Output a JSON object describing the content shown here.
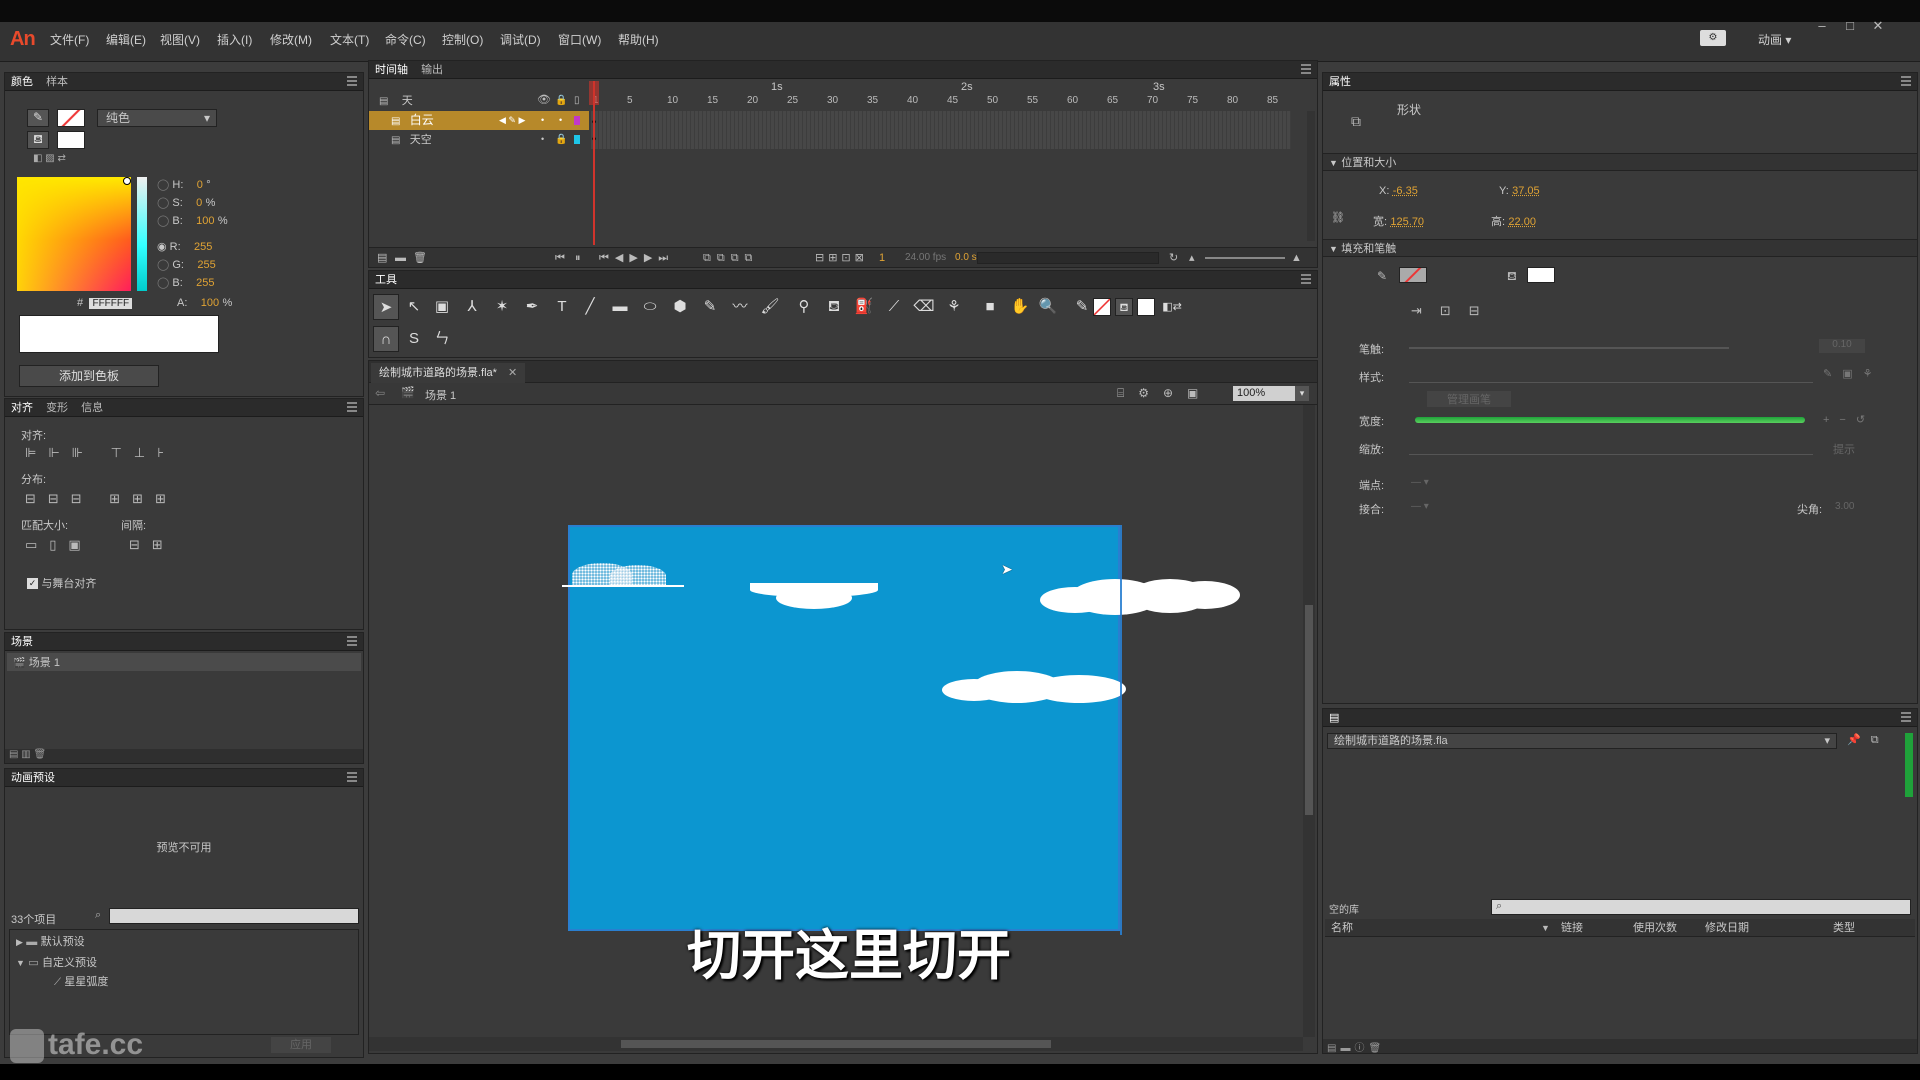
{
  "app": {
    "logo": "An",
    "workspace": "动画"
  },
  "menu": [
    "文件(F)",
    "编辑(E)",
    "视图(V)",
    "插入(I)",
    "修改(M)",
    "文本(T)",
    "命令(C)",
    "控制(O)",
    "调试(D)",
    "窗口(W)",
    "帮助(H)"
  ],
  "color_panel": {
    "tabs": [
      "颜色",
      "样本"
    ],
    "fill_type": "纯色",
    "hsb": {
      "h_label": "H:",
      "h": "0",
      "h_unit": "°",
      "s_label": "S:",
      "s": "0",
      "s_unit": "%",
      "b_label": "B:",
      "b": "100",
      "b_unit": "%"
    },
    "rgb": {
      "r_label": "R:",
      "r": "255",
      "g_label": "G:",
      "g": "255",
      "b_label": "B:",
      "b": "255"
    },
    "hex_label": "#",
    "hex": "FFFFFF",
    "alpha_label": "A:",
    "alpha": "100",
    "alpha_unit": "%",
    "add_swatch": "添加到色板"
  },
  "align_panel": {
    "tabs": [
      "对齐",
      "变形",
      "信息"
    ],
    "align_label": "对齐:",
    "distribute_label": "分布:",
    "match_label": "匹配大小:",
    "spacing_label": "间隔:",
    "stage_align": "与舞台对齐"
  },
  "scene_panel": {
    "title": "场景",
    "scene": "场景 1"
  },
  "motion_presets": {
    "title": "动画预设",
    "preview": "预览不可用",
    "count": "33个项目",
    "tree": [
      "默认预设",
      "自定义预设",
      "星星弧度"
    ],
    "apply": "应用"
  },
  "timeline": {
    "tabs": [
      "时间轴",
      "输出"
    ],
    "header_layer": "天",
    "layers": [
      "白云",
      "天空"
    ],
    "ruler_seconds": [
      "1s",
      "2s",
      "3s"
    ],
    "ruler_frames": [
      "1",
      "5",
      "10",
      "15",
      "20",
      "25",
      "30",
      "35",
      "40",
      "45",
      "50",
      "55",
      "60",
      "65",
      "70",
      "75",
      "80",
      "85"
    ],
    "current_frame": "1",
    "fps": "24.00 fps",
    "time": "0.0 s"
  },
  "tools_panel": {
    "title": "工具"
  },
  "document": {
    "tab": "绘制城市道路的场景.fla*",
    "scene": "场景 1",
    "zoom": "100%"
  },
  "stage": {
    "background": "#0c96d0"
  },
  "subtitle": "切开这里切开",
  "watermark": "tafe.cc",
  "properties": {
    "title": "属性",
    "type": "形状",
    "pos_size": "位置和大小",
    "x_label": "X:",
    "x": "-6.35",
    "y_label": "Y:",
    "y": "37.05",
    "w_label": "宽:",
    "w": "125.70",
    "h_label": "高:",
    "h": "22.00",
    "fill_stroke": "填充和笔触",
    "stroke_label": "笔触:",
    "stroke_val": "0.10",
    "style_label": "样式:",
    "manage": "管理画笔",
    "width_label": "宽度:",
    "scale_label": "缩放:",
    "hint": "提示",
    "cap_label": "端点:",
    "join_label": "接合:",
    "miter_label": "尖角:",
    "miter": "3.00"
  },
  "library": {
    "file": "绘制城市道路的场景.fla",
    "empty": "空的库",
    "columns": [
      "名称",
      "链接",
      "使用次数",
      "修改日期",
      "类型"
    ]
  },
  "colors": {
    "accent": "#e0a334",
    "selected_layer": "#b7892a",
    "playhead": "#d0342c"
  }
}
